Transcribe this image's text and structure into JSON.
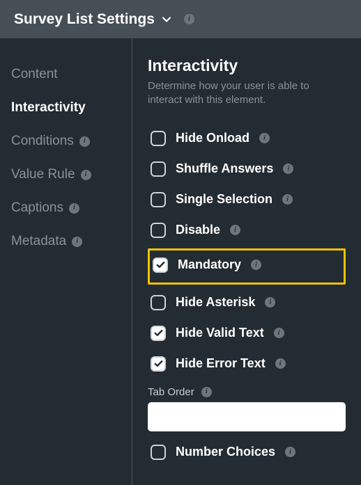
{
  "header": {
    "title": "Survey List Settings"
  },
  "sidebar": {
    "items": [
      {
        "label": "Content",
        "info": false,
        "active": false
      },
      {
        "label": "Interactivity",
        "info": false,
        "active": true
      },
      {
        "label": "Conditions",
        "info": true,
        "active": false
      },
      {
        "label": "Value Rule",
        "info": true,
        "active": false
      },
      {
        "label": "Captions",
        "info": true,
        "active": false
      },
      {
        "label": "Metadata",
        "info": true,
        "active": false
      }
    ]
  },
  "panel": {
    "title": "Interactivity",
    "description": "Determine how your user is able to interact with this element.",
    "options": [
      {
        "label": "Hide Onload",
        "checked": false,
        "info": true,
        "highlight": false
      },
      {
        "label": "Shuffle Answers",
        "checked": false,
        "info": true,
        "highlight": false
      },
      {
        "label": "Single Selection",
        "checked": false,
        "info": true,
        "highlight": false
      },
      {
        "label": "Disable",
        "checked": false,
        "info": true,
        "highlight": false
      },
      {
        "label": "Mandatory",
        "checked": true,
        "info": true,
        "highlight": true
      },
      {
        "label": "Hide Asterisk",
        "checked": false,
        "info": true,
        "highlight": false
      },
      {
        "label": "Hide Valid Text",
        "checked": true,
        "info": true,
        "highlight": false
      },
      {
        "label": "Hide Error Text",
        "checked": true,
        "info": true,
        "highlight": false
      }
    ],
    "tab_order": {
      "label": "Tab Order",
      "value": ""
    },
    "trailing_options": [
      {
        "label": "Number Choices",
        "checked": false,
        "info": true,
        "highlight": false
      }
    ]
  }
}
